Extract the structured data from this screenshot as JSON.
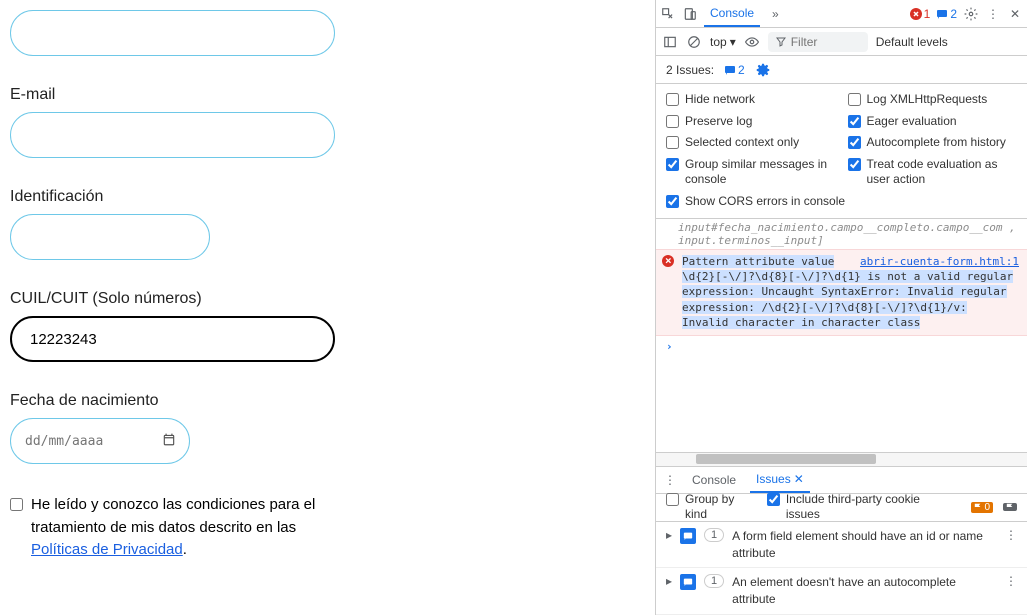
{
  "form": {
    "email_label": "E-mail",
    "id_label": "Identificación",
    "cuil_label": "CUIL/CUIT (Solo números)",
    "cuil_value": "12223243",
    "birth_label": "Fecha de nacimiento",
    "birth_placeholder": "dd/mm/aaaa",
    "terms_prefix": "He leído y conozco las condiciones para el tratamiento de mis datos descrito en las ",
    "terms_link": "Políticas de Privacidad",
    "terms_suffix": "."
  },
  "devtools": {
    "tabs": {
      "console": "Console",
      "more": "»"
    },
    "error_count": "1",
    "msg_count": "2",
    "context": "top",
    "filter_placeholder": "Filter",
    "levels": "Default levels",
    "issues_label": "2 Issues:",
    "issues_count": "2",
    "settings": {
      "hide_network": "Hide network",
      "log_xhr": "Log XMLHttpRequests",
      "preserve_log": "Preserve log",
      "eager_eval": "Eager evaluation",
      "selected_context": "Selected context only",
      "autocomplete_history": "Autocomplete from history",
      "group_similar": "Group similar messages in console",
      "treat_eval": "Treat code evaluation as user action",
      "show_cors": "Show CORS errors in console"
    },
    "checked": {
      "hide_network": false,
      "log_xhr": false,
      "preserve_log": false,
      "eager_eval": true,
      "selected_context": false,
      "autocomplete_history": true,
      "group_similar": true,
      "treat_eval": true,
      "show_cors": true
    },
    "console_log": {
      "tail": "input#fecha_nacimiento.campo__completo.campo__com , input.terminos__input]",
      "error_text": "Pattern attribute value \\d{2}[-\\/]?\\d{8}[-\\/]?\\d{1} is not a valid regular expression: Uncaught SyntaxError: Invalid regular expression: /\\d{2}[-\\/]?\\d{8}[-\\/]?\\d{1}/v: Invalid character in character class",
      "error_file": "abrir-cuenta-form.html:1"
    },
    "drawer": {
      "console_tab": "Console",
      "issues_tab": "Issues",
      "group_by_kind": "Group by kind",
      "include_third": "Include third-party cookie issues",
      "flag_count": "0",
      "issue1": "A form field element should have an id or name attribute",
      "issue2": "An element doesn't have an autocomplete attribute",
      "issue1_count": "1",
      "issue2_count": "1"
    }
  }
}
